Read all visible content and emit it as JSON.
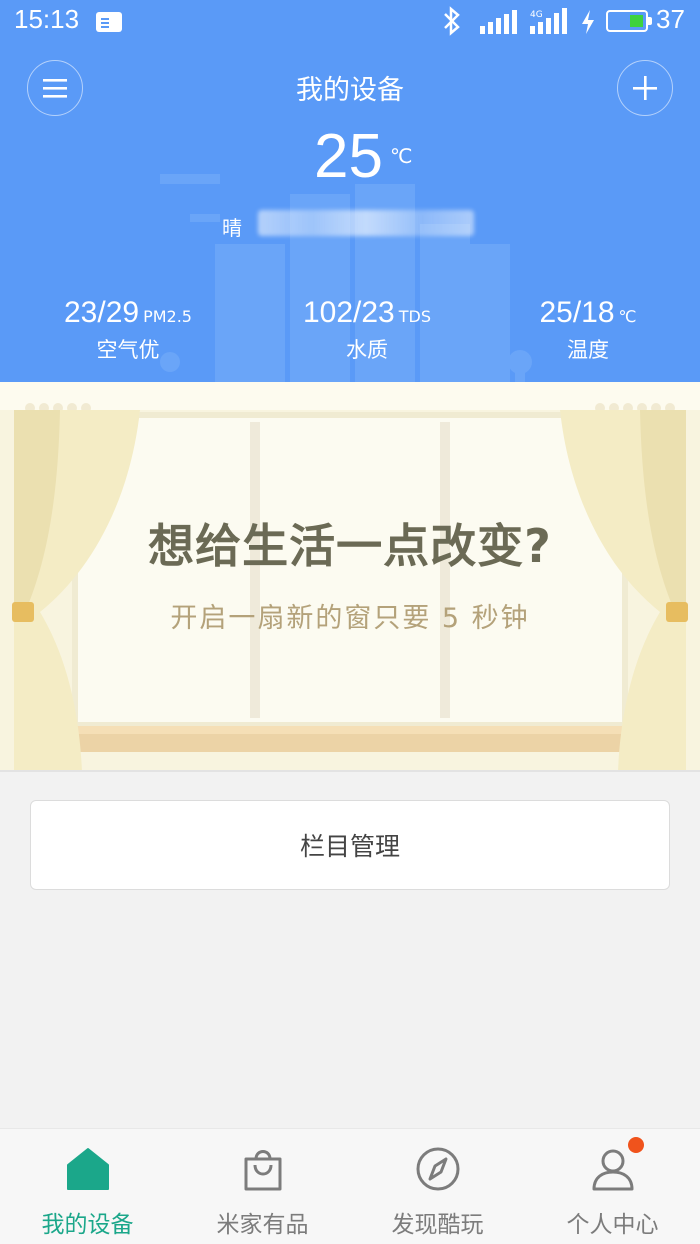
{
  "status_bar": {
    "time": "15:13",
    "battery_level": "37",
    "icons": [
      "sim-card-icon",
      "bluetooth-icon",
      "signal-icon",
      "4g-signal-icon",
      "charging-icon",
      "battery-icon"
    ]
  },
  "header": {
    "title": "我的设备",
    "menu_icon": "menu-icon",
    "add_icon": "plus-icon",
    "temperature": "25",
    "temperature_unit": "℃",
    "weather": "晴",
    "stats": [
      {
        "value": "23/29",
        "unit": "PM2.5",
        "label": "空气优"
      },
      {
        "value": "102/23",
        "unit": "TDS",
        "label": "水质"
      },
      {
        "value": "25/18",
        "unit": "℃",
        "label": "温度"
      }
    ],
    "accent_color": "#5a9af7"
  },
  "banner": {
    "title": "想给生活一点改变?",
    "subtitle": "开启一扇新的窗只要 5 秒钟"
  },
  "manage_button": {
    "label": "栏目管理"
  },
  "bottom_nav": {
    "items": [
      {
        "label": "我的设备",
        "icon": "home-icon",
        "active": true
      },
      {
        "label": "米家有品",
        "icon": "shopping-bag-icon",
        "active": false
      },
      {
        "label": "发现酷玩",
        "icon": "compass-icon",
        "active": false
      },
      {
        "label": "个人中心",
        "icon": "person-icon",
        "active": false
      }
    ],
    "active_color": "#1ba78a"
  }
}
